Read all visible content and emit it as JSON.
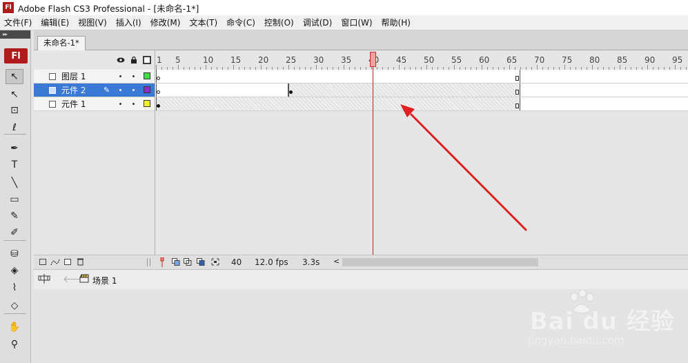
{
  "window": {
    "title": "Adobe Flash CS3 Professional - [未命名-1*]",
    "app_icon_text": "Fl"
  },
  "menu": [
    "文件(F)",
    "编辑(E)",
    "视图(V)",
    "插入(I)",
    "修改(M)",
    "文本(T)",
    "命令(C)",
    "控制(O)",
    "调试(D)",
    "窗口(W)",
    "帮助(H)"
  ],
  "toolbar": {
    "logo": "Fl",
    "tools": [
      {
        "name": "selection-tool-icon",
        "glyph": "↖",
        "active": true
      },
      {
        "name": "subselection-tool-icon",
        "glyph": "↖"
      },
      {
        "name": "free-transform-tool-icon",
        "glyph": "⊡"
      },
      {
        "name": "lasso-tool-icon",
        "glyph": "ℓ"
      },
      {
        "name": "pen-tool-icon",
        "glyph": "✒"
      },
      {
        "name": "text-tool-icon",
        "glyph": "T"
      },
      {
        "name": "line-tool-icon",
        "glyph": "╲"
      },
      {
        "name": "rectangle-tool-icon",
        "glyph": "▭"
      },
      {
        "name": "pencil-tool-icon",
        "glyph": "✎"
      },
      {
        "name": "brush-tool-icon",
        "glyph": "✐"
      },
      {
        "name": "ink-bottle-tool-icon",
        "glyph": "⛁"
      },
      {
        "name": "paint-bucket-tool-icon",
        "glyph": "◈"
      },
      {
        "name": "eyedropper-tool-icon",
        "glyph": "⌇"
      },
      {
        "name": "eraser-tool-icon",
        "glyph": "◇"
      },
      {
        "name": "hand-tool-icon",
        "glyph": "✋"
      },
      {
        "name": "zoom-tool-icon",
        "glyph": "⚲"
      }
    ]
  },
  "document_tab": "未命名-1*",
  "timeline": {
    "ruler_labels": [
      "1",
      "5",
      "10",
      "15",
      "20",
      "25",
      "30",
      "35",
      "40",
      "45",
      "50",
      "55",
      "60",
      "65",
      "70",
      "75",
      "80",
      "85",
      "90",
      "95"
    ],
    "current_frame": 40,
    "layers": [
      {
        "name": "图层 1",
        "color": "#3ee04a",
        "selected": false,
        "pencil": false,
        "span_start": 1,
        "span_end": 66,
        "hatched": false,
        "keyframes": [
          {
            "frame": 1,
            "type": "empty"
          }
        ]
      },
      {
        "name": "元件 2",
        "color": "#8b2fc9",
        "selected": true,
        "pencil": true,
        "span_start": 1,
        "span_end": 66,
        "hatched": true,
        "hatch_from": 25,
        "keyframes": [
          {
            "frame": 1,
            "type": "empty"
          },
          {
            "frame": 25,
            "type": "full"
          }
        ]
      },
      {
        "name": "元件 1",
        "color": "#f2f22a",
        "selected": false,
        "pencil": false,
        "span_start": 1,
        "span_end": 66,
        "hatched": true,
        "hatch_from": 1,
        "keyframes": [
          {
            "frame": 1,
            "type": "full"
          }
        ]
      }
    ],
    "status": {
      "frame": "40",
      "fps": "12.0 fps",
      "time": "3.3s"
    }
  },
  "editbar": {
    "scene": "场景 1"
  },
  "watermark": {
    "main": "Bai du 经验",
    "sub": "jingyan.baidu.com"
  }
}
